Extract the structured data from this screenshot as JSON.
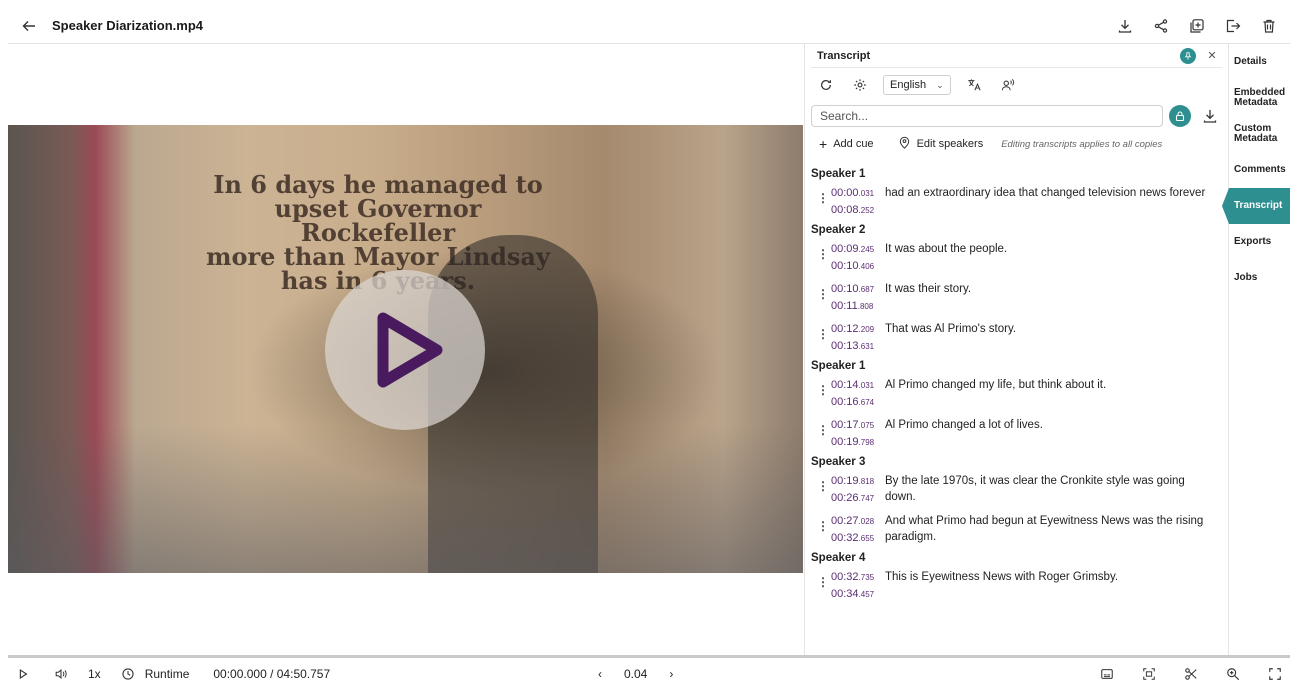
{
  "header": {
    "title": "Speaker Diarization.mp4",
    "icons": [
      "back-arrow-icon",
      "download-icon",
      "share-icon",
      "add-to-collection-icon",
      "export-icon",
      "trash-icon"
    ]
  },
  "transcript": {
    "title": "Transcript",
    "language": "English",
    "search_placeholder": "Search...",
    "add_cue_label": "Add cue",
    "edit_speakers_label": "Edit speakers",
    "note": "Editing transcripts applies to all copies",
    "accent_color": "#2d8f8f",
    "time_color": "#5a2d72",
    "groups": [
      {
        "speaker": "Speaker 1",
        "cues": [
          {
            "start_main": "00:00",
            "start_ms": ".031",
            "end_main": "00:08",
            "end_ms": ".252",
            "text": "had an extraordinary idea that changed television news forever"
          }
        ]
      },
      {
        "speaker": "Speaker 2",
        "cues": [
          {
            "start_main": "00:09",
            "start_ms": ".245",
            "end_main": "00:10",
            "end_ms": ".406",
            "text": "It was about the people."
          },
          {
            "start_main": "00:10",
            "start_ms": ".687",
            "end_main": "00:11",
            "end_ms": ".808",
            "text": "It was their story."
          },
          {
            "start_main": "00:12",
            "start_ms": ".209",
            "end_main": "00:13",
            "end_ms": ".631",
            "text": "That was Al Primo's story."
          }
        ]
      },
      {
        "speaker": "Speaker 1",
        "cues": [
          {
            "start_main": "00:14",
            "start_ms": ".031",
            "end_main": "00:16",
            "end_ms": ".674",
            "text": "Al Primo changed my life, but think about it."
          },
          {
            "start_main": "00:17",
            "start_ms": ".075",
            "end_main": "00:19",
            "end_ms": ".798",
            "text": "Al Primo changed a lot of lives."
          }
        ]
      },
      {
        "speaker": "Speaker 3",
        "cues": [
          {
            "start_main": "00:19",
            "start_ms": ".818",
            "end_main": "00:26",
            "end_ms": ".747",
            "text": "By the late 1970s, it was clear the Cronkite style was going down."
          },
          {
            "start_main": "00:27",
            "start_ms": ".028",
            "end_main": "00:32",
            "end_ms": ".655",
            "text": "And what Primo had begun at Eyewitness News was the rising paradigm."
          }
        ]
      },
      {
        "speaker": "Speaker 4",
        "cues": [
          {
            "start_main": "00:32",
            "start_ms": ".735",
            "end_main": "00:34",
            "end_ms": ".457",
            "text": "This is Eyewitness News with Roger Grimsby."
          }
        ]
      }
    ]
  },
  "tabs": [
    {
      "label": "Details",
      "active": false
    },
    {
      "label": "Embedded Metadata",
      "active": false
    },
    {
      "label": "Custom Metadata",
      "active": false
    },
    {
      "label": "Comments",
      "active": false
    },
    {
      "label": "Transcript",
      "active": true
    },
    {
      "label": "Exports",
      "active": false
    },
    {
      "label": "Jobs",
      "active": false
    }
  ],
  "video": {
    "headline_lines": [
      "In 6 days he managed to",
      "upset Governor Rockefeller",
      "more than Mayor Lindsay",
      "has in 6 years."
    ]
  },
  "player": {
    "speed": "1x",
    "runtime_label": "Runtime",
    "timecode": "00:00.000 / 04:50.757",
    "frame_step": "0.04",
    "progress": 0.0
  }
}
